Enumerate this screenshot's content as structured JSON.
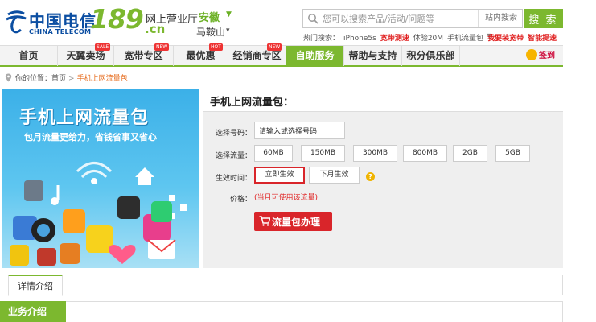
{
  "brand": {
    "name_cn": "中国电信",
    "name_en": "CHINA TELECOM",
    "number": "189",
    "domain_suffix": ".cn",
    "hall_title": "网上营业厅",
    "province": "安徽",
    "city": "马鞍山"
  },
  "search": {
    "placeholder": "您可以搜索产品/活动/问题等",
    "scope": "站内搜索",
    "button_label": "搜 索",
    "hot_label": "热门搜索：",
    "hot_items": [
      {
        "label": "iPhone5s",
        "highlight": false
      },
      {
        "label": "宽带测速",
        "highlight": true
      },
      {
        "label": "体验20M",
        "highlight": false
      },
      {
        "label": "手机流量包",
        "highlight": false
      },
      {
        "label": "我要装宽带",
        "highlight": true
      },
      {
        "label": "智能提速",
        "highlight": true
      }
    ]
  },
  "nav": {
    "items": [
      {
        "label": "首页",
        "badge": "",
        "active": false
      },
      {
        "label": "天翼卖场",
        "badge": "SALE",
        "active": false
      },
      {
        "label": "宽带专区",
        "badge": "NEW",
        "active": false
      },
      {
        "label": "最优惠",
        "badge": "HOT",
        "active": false
      },
      {
        "label": "经销商专区",
        "badge": "NEW",
        "active": false
      },
      {
        "label": "自助服务",
        "badge": "",
        "active": true
      },
      {
        "label": "帮助与支持",
        "badge": "",
        "active": false
      },
      {
        "label": "积分俱乐部",
        "badge": "",
        "active": false
      }
    ],
    "checkin_label": "签到"
  },
  "breadcrumb": {
    "prefix": "你的位置：",
    "home": "首页",
    "separator": ">",
    "current": "手机上网流量包"
  },
  "banner": {
    "title": "手机上网流量包",
    "subtitle": "包月流量更给力，省钱省事又省心"
  },
  "form": {
    "title": "手机上网流量包：",
    "phone_label": "选择号码：",
    "phone_value": "请输入或选择号码",
    "data_label": "选择流量：",
    "data_options": [
      "60MB",
      "150MB",
      "300MB",
      "800MB",
      "2GB",
      "5GB"
    ],
    "effective_label": "生效时间：",
    "effective_options": [
      "立即生效",
      "下月生效"
    ],
    "effective_selected": 0,
    "price_label": "价格：",
    "price_note": "(当月可使用该流量)",
    "order_button": "流量包办理"
  },
  "tabs": {
    "detail": "详情介绍"
  },
  "section": {
    "business_intro": "业务介绍"
  },
  "colors": {
    "brand_green": "#7cb82f",
    "brand_blue": "#0b4ea2",
    "action_red": "#d9252a"
  }
}
